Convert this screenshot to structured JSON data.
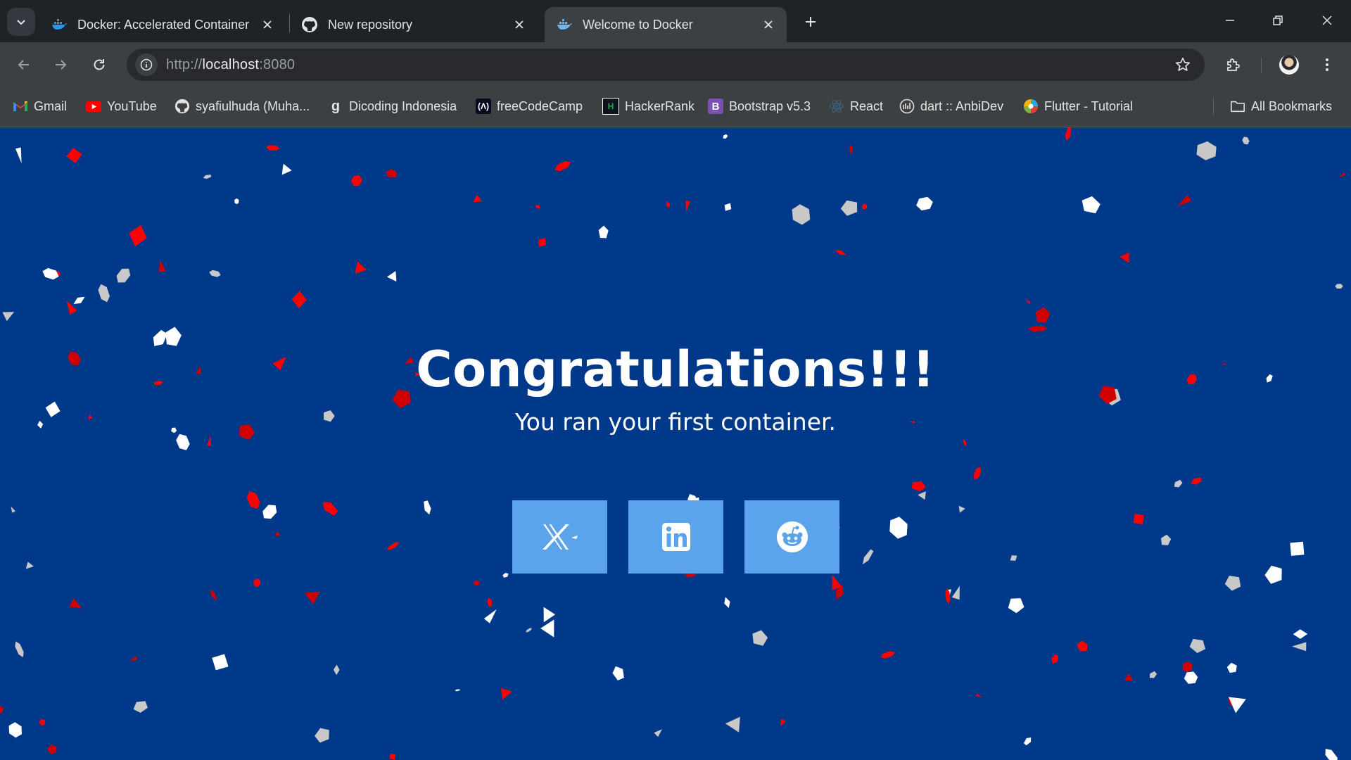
{
  "browser": {
    "tabs": [
      {
        "title": "Docker: Accelerated Container Application Development",
        "favicon": "docker-icon",
        "active": false
      },
      {
        "title": "New repository",
        "favicon": "github-icon",
        "active": false
      },
      {
        "title": "Welcome to Docker",
        "favicon": "docker-icon",
        "active": true
      }
    ],
    "url": {
      "scheme": "http://",
      "host": "localhost",
      "port": ":8080"
    },
    "bookmarks": [
      {
        "label": "Gmail",
        "icon": "gmail-icon"
      },
      {
        "label": "YouTube",
        "icon": "youtube-icon"
      },
      {
        "label": "syafiulhuda (Muha...",
        "icon": "github-icon"
      },
      {
        "label": "Dicoding Indonesia",
        "icon": "dicoding-icon"
      },
      {
        "label": "freeCodeCamp",
        "icon": "freecodecamp-icon"
      },
      {
        "label": "HackerRank",
        "icon": "hackerrank-icon"
      },
      {
        "label": "Bootstrap v5.3",
        "icon": "bootstrap-icon"
      },
      {
        "label": "React",
        "icon": "react-icon"
      },
      {
        "label": "dart :: AnbiDev",
        "icon": "anbidev-icon"
      },
      {
        "label": "Flutter - Tutorial",
        "icon": "flutter-icon"
      }
    ],
    "all_bookmarks": "All Bookmarks"
  },
  "page": {
    "headline": "Congratulations!!!",
    "subline": "You ran your first container.",
    "share_buttons": [
      {
        "name": "x-twitter",
        "icon": "x-icon"
      },
      {
        "name": "linkedin",
        "icon": "linkedin-icon"
      },
      {
        "name": "reddit",
        "icon": "reddit-icon"
      }
    ]
  },
  "colors": {
    "page_background": "#00398a",
    "share_button": "#5ba3eb",
    "confetti": [
      "#ff0000",
      "#d10000",
      "#ffffff",
      "#c8c8c8"
    ]
  }
}
